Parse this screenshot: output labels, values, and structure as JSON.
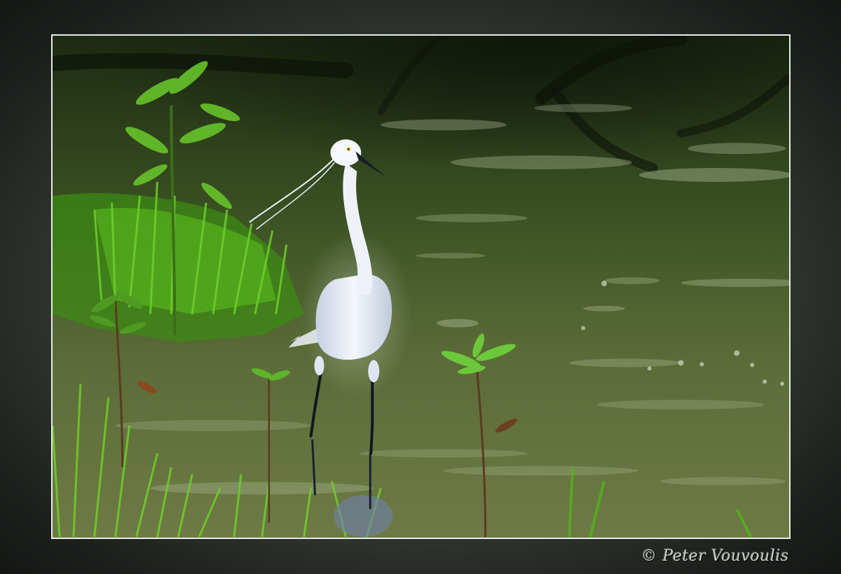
{
  "watermark": {
    "copyright_symbol": "©",
    "author": "Peter Vouvoulis"
  },
  "colors": {
    "frame_outer": "#141714",
    "frame_inner": "#5a605a",
    "photo_border": "#e9ece8",
    "water_dark": "#2e4219",
    "water_light": "#7c8a52",
    "grass": "#52b41c",
    "egret_white": "#eef2f8",
    "egret_shadow": "#b9c3d6"
  },
  "icons": {
    "subject": "egret-icon"
  }
}
